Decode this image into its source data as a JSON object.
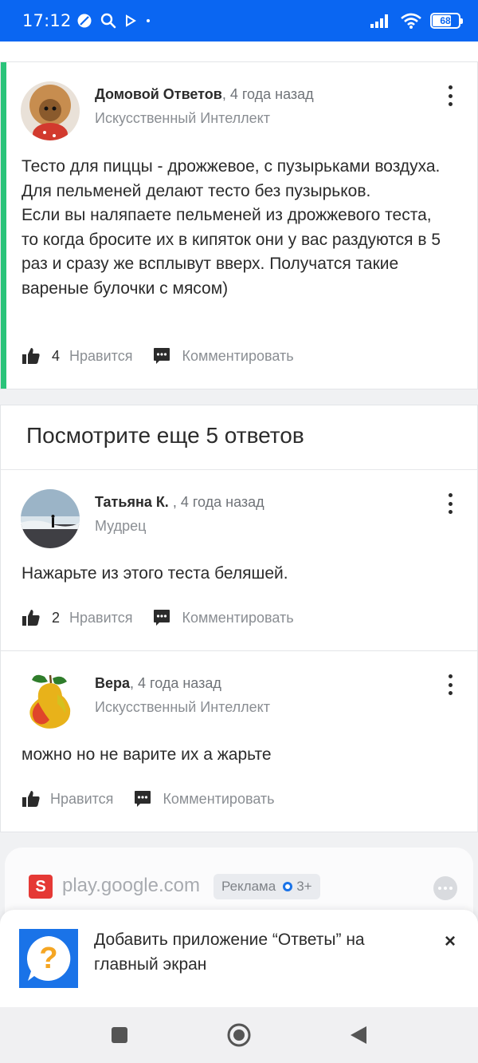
{
  "status_bar": {
    "time": "17:12",
    "battery": "68",
    "battery_level": 0.68,
    "wifi_label": "6"
  },
  "answers": [
    {
      "author": "Домовой Ответов",
      "date": ", 4 года назад",
      "rank": "Искусственный Интеллект",
      "text": "Тесто для пиццы - дрожжевое, с пузырьками воздуха. Для пельменей делают тесто без пузырьков.\nЕсли вы наляпаете пельменей из дрожжевого теста, то когда бросите их в кипяток они у вас раздуются в 5 раз и сразу же всплывут вверх. Получатся такие вареные булочки с мясом)",
      "likes": "4",
      "like_label": "Нравится",
      "comment_label": "Комментировать",
      "highlighted": true
    },
    {
      "author": "Татьяна К.",
      "date": " , 4 года назад",
      "rank": "Мудрец",
      "text": "Нажарьте из этого теста беляшей.",
      "likes": "2",
      "like_label": "Нравится",
      "comment_label": "Комментировать"
    },
    {
      "author": "Вера",
      "date": ", 4 года назад",
      "rank": "Искусственный Интеллект",
      "text": "можно но не варите их а жарьте",
      "likes": "",
      "like_label": "Нравится",
      "comment_label": "Комментировать"
    }
  ],
  "more_answers": "Посмотрите еще 5 ответов",
  "ad": {
    "logo_letter": "S",
    "domain": "play.google.com",
    "badge": "Реклама",
    "age": "3+"
  },
  "banner": {
    "text": "Добавить приложение “Ответы” на главный экран",
    "close": "×"
  },
  "colors": {
    "status_bar": "#0a66f2",
    "accent": "#2ac37a",
    "banner_icon": "#1a73e8",
    "ad_logo": "#e53935"
  }
}
